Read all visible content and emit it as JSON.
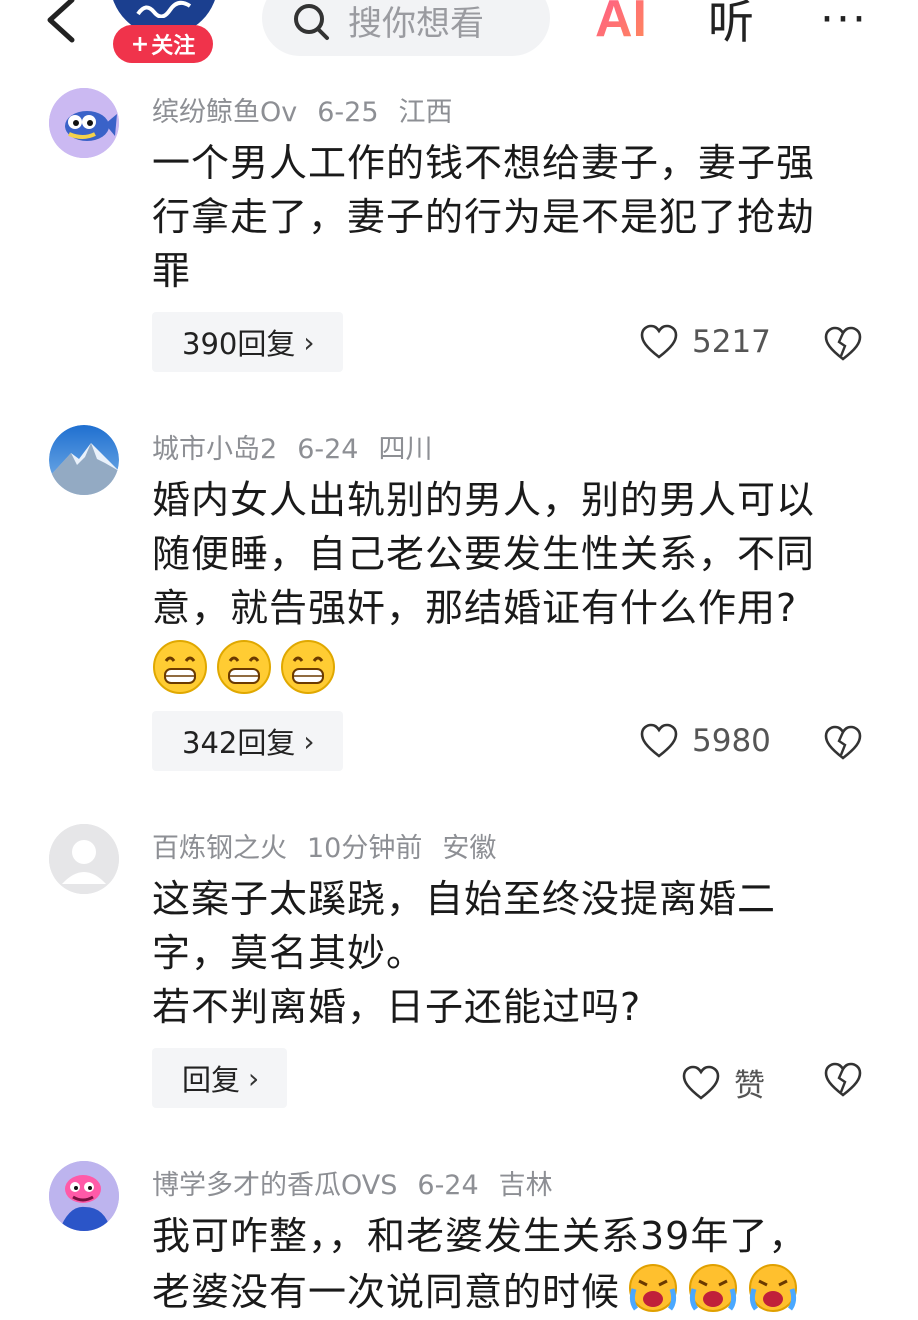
{
  "header": {
    "follow_label": "关注",
    "search_placeholder": "搜你想看",
    "ai_label": "AI",
    "listen_label": "听",
    "more_label": "···"
  },
  "comments": [
    {
      "author": "缤纷鲸鱼Ov",
      "date": "6-25",
      "location": "江西",
      "lines": [
        "一个男人工作的钱不想给妻子，妻子强",
        "行拿走了，妻子的行为是不是犯了抢劫",
        "罪"
      ],
      "reply_label": "390回复",
      "likes": "5217"
    },
    {
      "author": "城市小岛2",
      "date": "6-24",
      "location": "四川",
      "lines": [
        "婚内女人出轨别的男人，别的男人可以",
        "随便睡，自己老公要发生性关系，不同",
        "意，就告强奸，那结婚证有什么作用?"
      ],
      "emoji": [
        "grin-emoji",
        "grin-emoji",
        "grin-emoji"
      ],
      "reply_label": "342回复",
      "likes": "5980"
    },
    {
      "author": "百炼钢之火",
      "date": "10分钟前",
      "location": "安徽",
      "lines": [
        "这案子太蹊跷，自始至终没提离婚二",
        "字，莫名其妙。",
        "若不判离婚，日子还能过吗?"
      ],
      "reply_label": "回复",
      "likes": "赞"
    },
    {
      "author": "博学多才的香瓜OVS",
      "date": "6-24",
      "location": "吉林",
      "lines": [
        "我可咋整，，和老婆发生关系39年了，",
        "老婆没有一次说同意的时候"
      ],
      "emoji": [
        "crying-emoji",
        "crying-emoji",
        "crying-emoji"
      ]
    }
  ],
  "colors": {
    "follow_red": "#f0334b",
    "meta_gray": "#8d8f94",
    "reply_bg": "#f4f5f7"
  }
}
